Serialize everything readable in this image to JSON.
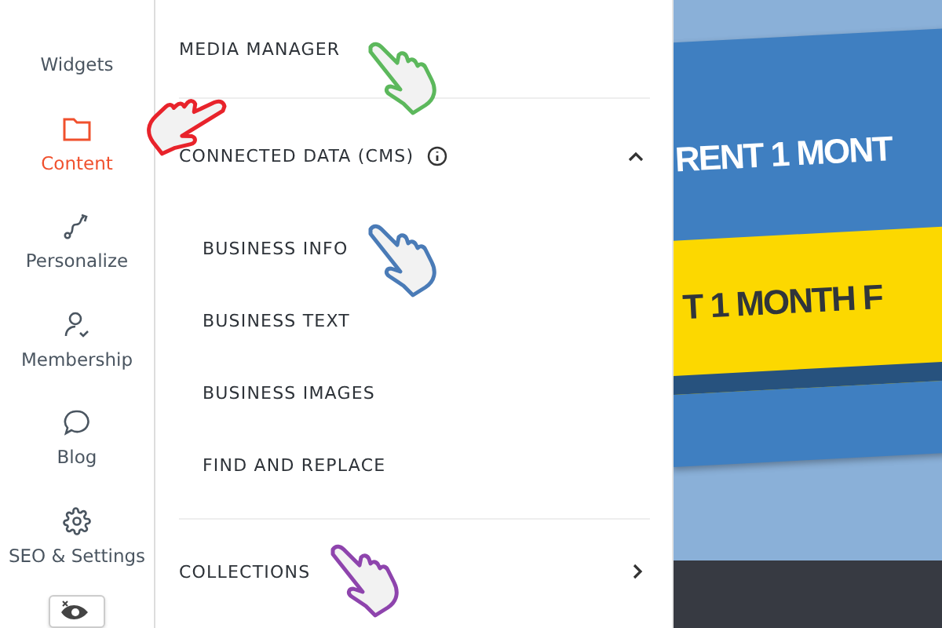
{
  "sidebar": {
    "items": [
      {
        "label": "Widgets",
        "selected": false
      },
      {
        "label": "Content",
        "selected": true
      },
      {
        "label": "Personalize",
        "selected": false
      },
      {
        "label": "Membership",
        "selected": false
      },
      {
        "label": "Blog",
        "selected": false
      },
      {
        "label": "SEO & Settings",
        "selected": false
      }
    ]
  },
  "panel": {
    "sections": [
      {
        "label": "MEDIA MANAGER",
        "kind": "link"
      },
      {
        "label": "CONNECTED DATA (CMS)",
        "kind": "group",
        "expanded": true,
        "children": [
          {
            "label": "BUSINESS INFO"
          },
          {
            "label": "BUSINESS TEXT"
          },
          {
            "label": "BUSINESS IMAGES"
          },
          {
            "label": "FIND AND REPLACE"
          }
        ]
      },
      {
        "label": "COLLECTIONS",
        "kind": "nav"
      }
    ]
  },
  "preview": {
    "banner_top": "RENT 1 MONT",
    "banner_middle": "T 1 MONTH F"
  },
  "annotations": [
    {
      "color": "#e8232b"
    },
    {
      "color": "#5cb85c"
    },
    {
      "color": "#4a7bb7"
    },
    {
      "color": "#8e44ad"
    }
  ]
}
